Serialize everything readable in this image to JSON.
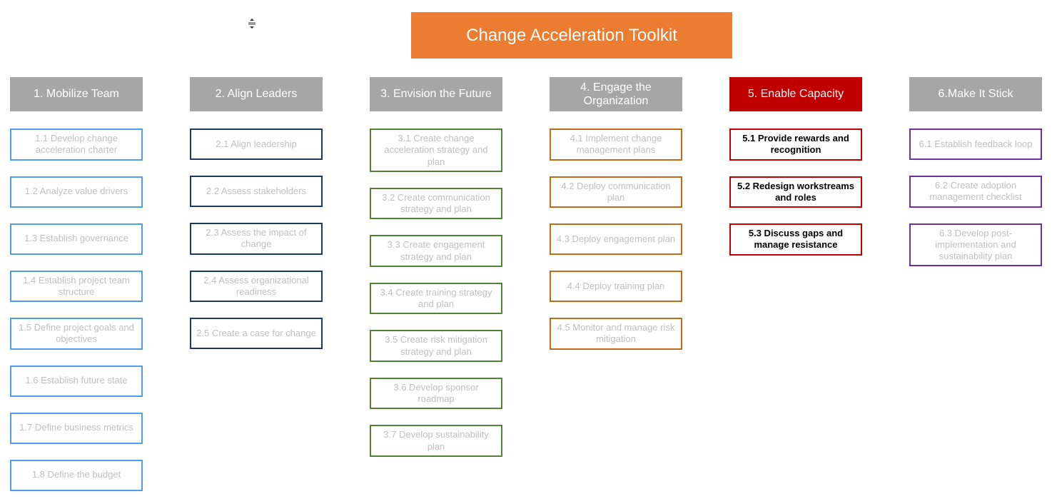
{
  "title": "Change Acceleration Toolkit",
  "resize_glyph": "⇳",
  "columns": [
    {
      "header": "1. Mobilize Team",
      "selected": false,
      "items": [
        {
          "label": "1.1 Develop change acceleration charter",
          "active": false
        },
        {
          "label": "1.2 Analyze value drivers",
          "active": false
        },
        {
          "label": "1.3 Establish governance",
          "active": false
        },
        {
          "label": "1.4 Establish project team structure",
          "active": false
        },
        {
          "label": "1.5 Define project goals and objectives",
          "active": false
        },
        {
          "label": "1.6 Establish future state",
          "active": false
        },
        {
          "label": "1.7 Define business metrics",
          "active": false
        },
        {
          "label": "1.8 Define the budget",
          "active": false
        }
      ]
    },
    {
      "header": "2. Align Leaders",
      "selected": false,
      "items": [
        {
          "label": "2.1 Align leadership",
          "active": false
        },
        {
          "label": "2.2 Assess stakeholders",
          "active": false
        },
        {
          "label": "2.3 Assess the impact of change",
          "active": false
        },
        {
          "label": "2.4 Assess organizational readiness",
          "active": false
        },
        {
          "label": "2.5 Create a case for change",
          "active": false
        }
      ]
    },
    {
      "header": "3. Envision the Future",
      "selected": false,
      "items": [
        {
          "label": "3.1 Create change acceleration strategy and plan",
          "active": false
        },
        {
          "label": "3.2 Create communication strategy and plan",
          "active": false
        },
        {
          "label": "3.3 Create engagement strategy and plan",
          "active": false
        },
        {
          "label": "3.4 Create training strategy and plan",
          "active": false
        },
        {
          "label": "3.5 Create risk mitigation strategy and plan",
          "active": false
        },
        {
          "label": "3.6 Develop sponsor roadmap",
          "active": false
        },
        {
          "label": "3.7 Develop sustainability plan",
          "active": false
        }
      ]
    },
    {
      "header": "4. Engage the Organization",
      "selected": false,
      "items": [
        {
          "label": "4.1 Implement change management plans",
          "active": false
        },
        {
          "label": "4.2 Deploy communication plan",
          "active": false
        },
        {
          "label": "4.3 Deploy engagement plan",
          "active": false
        },
        {
          "label": "4.4 Deploy training plan",
          "active": false
        },
        {
          "label": "4.5 Monitor and manage risk mitigation",
          "active": false
        }
      ]
    },
    {
      "header": "5. Enable Capacity",
      "selected": true,
      "items": [
        {
          "label": "5.1 Provide rewards and recognition",
          "active": true
        },
        {
          "label": "5.2 Redesign workstreams and roles",
          "active": true
        },
        {
          "label": "5.3 Discuss gaps and manage resistance",
          "active": true
        }
      ]
    },
    {
      "header": "6.Make It Stick",
      "selected": false,
      "items": [
        {
          "label": "6.1 Establish feedback loop",
          "active": false
        },
        {
          "label": "6.2 Create adoption management checklist",
          "active": false
        },
        {
          "label": "6.3 Develop post-implementation and sustainability plan",
          "active": false
        }
      ]
    }
  ]
}
